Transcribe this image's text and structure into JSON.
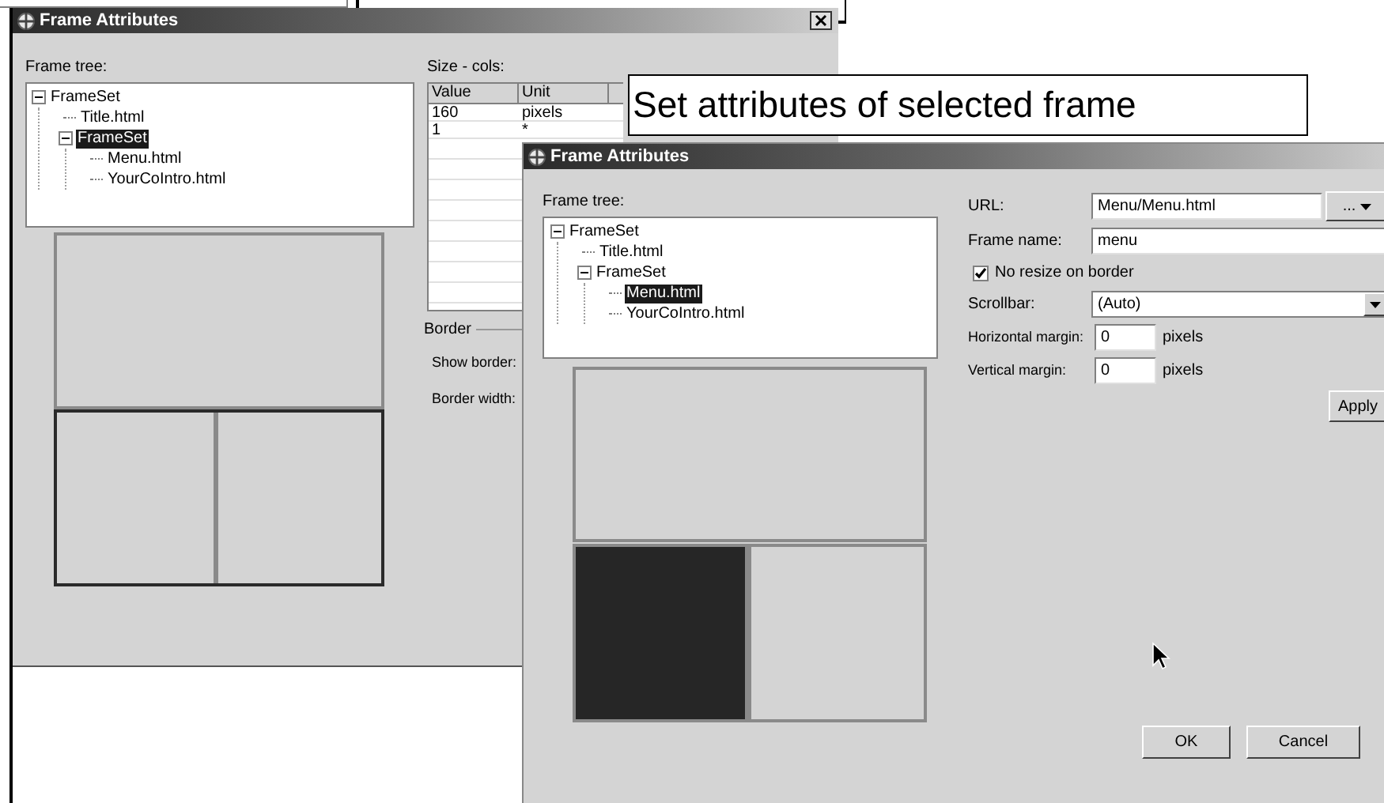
{
  "callout": {
    "text": "Set attributes of selected frame"
  },
  "back_window": {
    "title": "Frame Attributes",
    "frame_tree_label": "Frame tree:",
    "tree": [
      {
        "label": "FrameSet",
        "expanded": true,
        "selected": false,
        "children": [
          {
            "label": "Title.html",
            "selected": false
          },
          {
            "label": "FrameSet",
            "expanded": true,
            "selected": true,
            "children": [
              {
                "label": "Menu.html",
                "selected": false
              },
              {
                "label": "YourCoIntro.html",
                "selected": false
              }
            ]
          }
        ]
      }
    ],
    "preview": {
      "bottom_row_selected": true
    },
    "size_label": "Size - cols:",
    "columns": [
      "Value",
      "Unit"
    ],
    "rows": [
      [
        "160",
        "pixels"
      ],
      [
        "1",
        "*"
      ]
    ],
    "border_label": "Border",
    "show_border_label": "Show border:",
    "border_width_label": "Border width:"
  },
  "front_window": {
    "title": "Frame Attributes",
    "frame_tree_label": "Frame tree:",
    "tree": [
      {
        "label": "FrameSet",
        "expanded": true,
        "selected": false,
        "children": [
          {
            "label": "Title.html",
            "selected": false
          },
          {
            "label": "FrameSet",
            "expanded": true,
            "selected": false,
            "children": [
              {
                "label": "Menu.html",
                "selected": true
              },
              {
                "label": "YourCoIntro.html",
                "selected": false
              }
            ]
          }
        ]
      }
    ],
    "preview": [
      {
        "selected": false
      },
      {
        "selected": true
      },
      {
        "selected": false
      }
    ],
    "url_label": "URL:",
    "url_value": "Menu/Menu.html",
    "browse_button": "...",
    "frame_name_label": "Frame name:",
    "frame_name_value": "menu",
    "no_resize": {
      "label": "No resize on border",
      "checked": true
    },
    "scrollbar_label": "Scrollbar:",
    "scrollbar_value": "(Auto)",
    "horizontal_margin_label": "Horizontal margin:",
    "horizontal_margin_value": "0",
    "horizontal_margin_unit": "pixels",
    "vertical_margin_label": "Vertical margin:",
    "vertical_margin_value": "0",
    "vertical_margin_unit": "pixels",
    "apply_button": "Apply",
    "ok_button": "OK",
    "cancel_button": "Cancel"
  }
}
